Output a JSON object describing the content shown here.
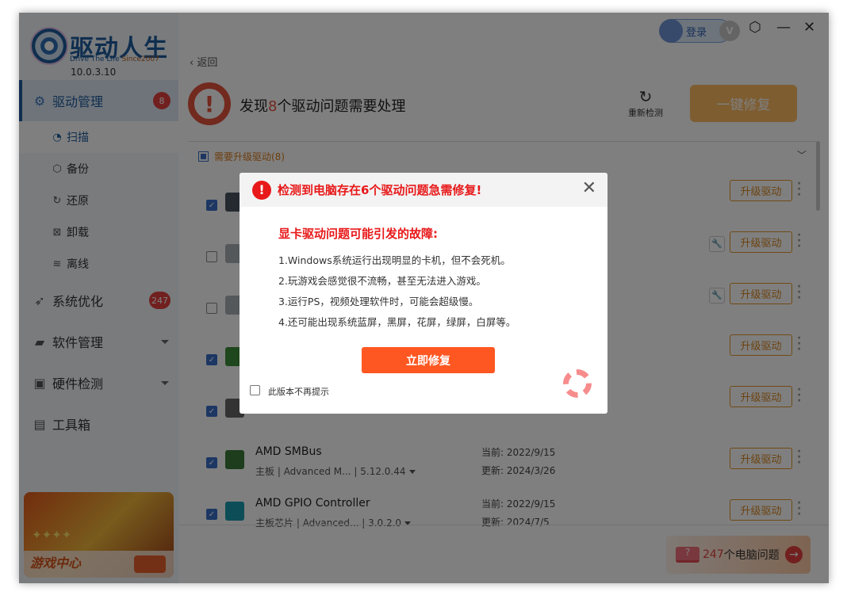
{
  "app": {
    "brand": "驱动人生",
    "tagline": "Drive The Life",
    "since": "Since2007",
    "version": "10.0.3.10"
  },
  "topbar": {
    "login": "登录",
    "vip": "V"
  },
  "sidebar": {
    "items": [
      {
        "label": "驱动管理",
        "badge": "8"
      },
      {
        "label": "系统优化",
        "badge": "247"
      },
      {
        "label": "软件管理"
      },
      {
        "label": "硬件检测"
      },
      {
        "label": "工具箱"
      }
    ],
    "subitems": [
      {
        "label": "扫描"
      },
      {
        "label": "备份"
      },
      {
        "label": "还原"
      },
      {
        "label": "卸载"
      },
      {
        "label": "离线"
      }
    ],
    "banner": {
      "title": "游戏中心"
    }
  },
  "main": {
    "back": "返回",
    "header_pre": "发现",
    "header_count": "8",
    "header_post": "个驱动问题需要处理",
    "refresh": "重新检测",
    "fix_all": "一键修复",
    "section": "需要升级驱动(8)",
    "upgrade_label": "升级驱动",
    "rows": [
      {
        "checked": true
      },
      {
        "checked": false,
        "wrench": true
      },
      {
        "checked": false,
        "wrench": true
      },
      {
        "checked": true
      },
      {
        "checked": true
      },
      {
        "checked": true,
        "name": "AMD SMBus",
        "category": "主板",
        "vendor": "Advanced  M...",
        "version": "5.12.0.44",
        "current": "当前: 2022/9/15",
        "update": "更新: 2024/3/26"
      },
      {
        "checked": true,
        "name": "AMD GPIO Controller",
        "category": "主板芯片",
        "vendor": "Advanced...",
        "version": "3.0.2.0",
        "current": "当前: 2022/9/15",
        "update": "更新: 2024/7/5"
      }
    ],
    "problems_count": "247",
    "problems_label": "个电脑问题"
  },
  "modal": {
    "title": "检测到电脑存在6个驱动问题急需修复!",
    "subtitle": "显卡驱动问题可能引发的故障:",
    "lines": [
      "1.Windows系统运行出现明显的卡机，但不会死机。",
      "2.玩游戏会感觉很不流畅，甚至无法进入游戏。",
      "3.运行PS，视频处理软件时，可能会超级慢。",
      "4.还可能出现系统蓝屏，黑屏，花屏，绿屏，白屏等。"
    ],
    "fix_now": "立即修复",
    "dont_show": "此版本不再提示"
  },
  "colors": {
    "accent": "#1e5d9e",
    "danger": "#e8191a",
    "orange": "#ff5722",
    "upgrade": "#e1952a"
  }
}
